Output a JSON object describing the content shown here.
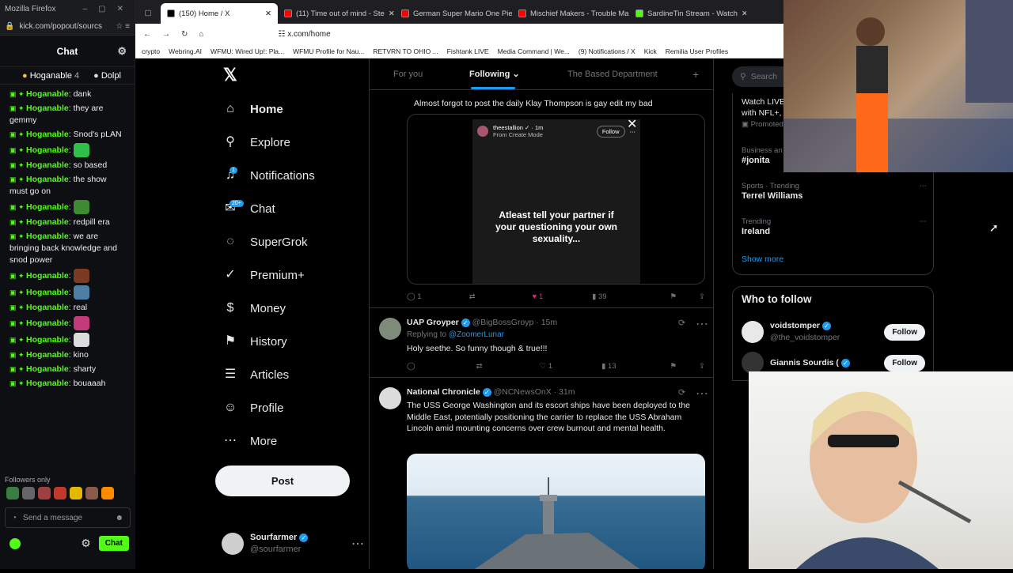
{
  "chat_window": {
    "title": "Mozilla Firefox",
    "url": "kick.com/popout/sourcs",
    "header": "Chat",
    "pinned": [
      {
        "name": "Hoganable",
        "count": "4"
      },
      {
        "name": "Dolpl"
      }
    ],
    "messages": [
      {
        "user": "Hoganable",
        "text": "dank"
      },
      {
        "user": "Hoganable",
        "text": "they are gemmy"
      },
      {
        "user": "Hoganable",
        "text": "Snod's pLAN"
      },
      {
        "user": "Hoganable",
        "text": "",
        "emote": "#2ec04a"
      },
      {
        "user": "Hoganable",
        "text": "so based"
      },
      {
        "user": "Hoganable",
        "text": "the show must go on"
      },
      {
        "user": "Hoganable",
        "text": "",
        "emote": "#3c8a32"
      },
      {
        "user": "Hoganable",
        "text": "redpill era"
      },
      {
        "user": "Hoganable",
        "text": "we are bringing back knowledge and snod power"
      },
      {
        "user": "Hoganable",
        "text": "",
        "emote": "#7a3b22"
      },
      {
        "user": "Hoganable",
        "text": "",
        "emote": "#4d7fa6"
      },
      {
        "user": "Hoganable",
        "text": "real"
      },
      {
        "user": "Hoganable",
        "text": "",
        "emote": "#c43a7a"
      },
      {
        "user": "Hoganable",
        "text": "",
        "emote": "#dcdcdc"
      },
      {
        "user": "Hoganable",
        "text": "kino"
      },
      {
        "user": "Hoganable",
        "text": "sharty"
      },
      {
        "user": "Hoganable",
        "text": "bouaaah"
      }
    ],
    "followers_only": "Followers only",
    "input_placeholder": "Send a message",
    "chat_button": "Chat"
  },
  "tabs": [
    {
      "label": "(150) Home / X",
      "color": "#000000"
    },
    {
      "label": "(11) Time out of mind - Ste",
      "color": "#ff0000"
    },
    {
      "label": "German Super Mario One Piece",
      "color": "#ff0000"
    },
    {
      "label": "Mischief Makers - Trouble Maker",
      "color": "#ff0000"
    },
    {
      "label": "SardineTin Stream - Watch",
      "color": "#53fc18"
    }
  ],
  "address": "x.com/home",
  "bookmarks": [
    "crypto",
    "Webring.AI",
    "WFMU: Wired Up!: Pla...",
    "WFMU Profile for Nau...",
    "RETVRN TO OHIO ...",
    "Fishtank LIVE",
    "Media Command | We...",
    "(9) Notifications / X",
    "Kick",
    "Remilia User Profiles"
  ],
  "nav": [
    {
      "label": "Home",
      "icon": "home-icon",
      "glyph": "⌂"
    },
    {
      "label": "Explore",
      "icon": "search-icon",
      "glyph": "⚲"
    },
    {
      "label": "Notifications",
      "icon": "bell-icon",
      "glyph": "♫",
      "badge": "1"
    },
    {
      "label": "Chat",
      "icon": "chat-icon",
      "glyph": "✉",
      "badge": "20+"
    },
    {
      "label": "SuperGrok",
      "icon": "grok-icon",
      "glyph": "◌"
    },
    {
      "label": "Premium+",
      "icon": "premium-icon",
      "glyph": "✓"
    },
    {
      "label": "Money",
      "icon": "money-icon",
      "glyph": "$"
    },
    {
      "label": "History",
      "icon": "bookmark-icon",
      "glyph": "⚑"
    },
    {
      "label": "Articles",
      "icon": "articles-icon",
      "glyph": "☰"
    },
    {
      "label": "Profile",
      "icon": "profile-icon",
      "glyph": "☺"
    },
    {
      "label": "More",
      "icon": "more-icon",
      "glyph": "⋯"
    }
  ],
  "post_button": "Post",
  "account": {
    "name": "Sourfarmer",
    "handle": "@sourfarmer"
  },
  "feed_tabs": [
    "For you",
    "Following",
    "The Based Department"
  ],
  "tweet1": {
    "text": "Almost forgot to post the daily Klay Thompson is gay edit my bad",
    "embed_user": "theestallion",
    "embed_time": "1m",
    "embed_sub": "From Create Mode",
    "embed_follow": "Follow",
    "embed_caption": "Atleast tell your partner if your questioning your own sexuality...",
    "replies": "1",
    "likes": "1",
    "views": "39"
  },
  "tweet2": {
    "name": "UAP Groyper",
    "handle": "@BigBossGroyp",
    "time": "15m",
    "replying_label": "Replying to",
    "replying_to": "@ZoomerLunar",
    "text": "Holy seethe. So funny though & true!!!",
    "likes": "1",
    "views": "13"
  },
  "tweet3": {
    "name": "National Chronicle",
    "handle": "@NCNewsOnX",
    "time": "31m",
    "text": "The USS George Washington and its escort ships have been deployed to the Middle East, potentially positioning the carrier to replace the USS Abraham Lincoln amid mounting concerns over crew burnout and mental health."
  },
  "search_placeholder": "Search",
  "sidebar": {
    "promo_line1": "Watch LIVE",
    "promo_line2": "with NFL+,",
    "promoted": "Promoted",
    "trends": [
      {
        "meta": "Business an",
        "name": "#jonita"
      },
      {
        "meta": "Sports · Trending",
        "name": "Terrel Williams"
      },
      {
        "meta": "Trending",
        "name": "Ireland"
      }
    ],
    "show_more": "Show more",
    "who_to_follow": "Who to follow",
    "follow": [
      {
        "name": "voidstomper",
        "handle": "@the_voidstomper",
        "button": "Follow"
      },
      {
        "name": "Giannis Sourdis (",
        "button": "Follow"
      }
    ]
  }
}
